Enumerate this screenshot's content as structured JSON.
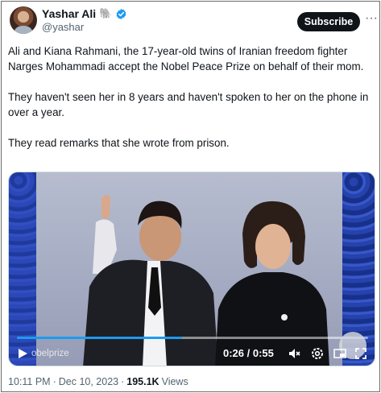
{
  "author": {
    "name": "Yashar Ali",
    "emoji": "🐘",
    "handle": "@yashar"
  },
  "subscribe_label": "Subscribe",
  "more_label": "···",
  "tweet": {
    "paragraphs": [
      "Ali and Kiana Rahmani, the 17-year-old twins of Iranian freedom fighter Narges Mohammadi accept the Nobel Peace Prize on behalf of their mom.",
      "They haven't seen her in 8 years and haven't spoken to her on the phone in over a year.",
      "They read remarks that she wrote from prison."
    ]
  },
  "video": {
    "watermark": "obelprize",
    "time": "0:26 / 0:55",
    "progress": 0.47
  },
  "meta": {
    "time": "10:11 PM",
    "sep1": "·",
    "date": "Dec 10, 2023",
    "sep2": "·",
    "views_count": "195.1K",
    "views_label": "Views"
  },
  "colors": {
    "accent": "#1d9bf0",
    "subscribe_bg": "#0f1419",
    "muted": "#536471"
  }
}
